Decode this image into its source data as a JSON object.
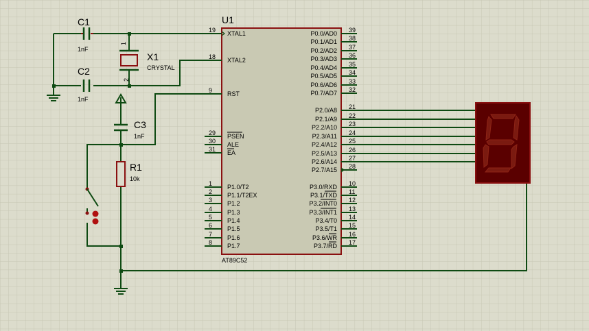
{
  "colors": {
    "background": "#dcdccc",
    "grid": "#c8c8b8",
    "wire": "#0e4a12",
    "component": "#8a1010",
    "chip_fill": "#c9c9b3",
    "display_fill": "#5a0000",
    "segment_off": "#7a1a10",
    "junction": "#0e4a12",
    "text": "#000000",
    "pin_number": "#000000"
  },
  "chip": {
    "ref": "U1",
    "part": "AT89C52",
    "left_pins": [
      {
        "num": "19",
        "name": "XTAL1"
      },
      {
        "num": "18",
        "name": "XTAL2"
      },
      {
        "num": "9",
        "name": "RST"
      },
      {
        "num": "29",
        "name": "PSEN"
      },
      {
        "num": "30",
        "name": "ALE"
      },
      {
        "num": "31",
        "name": "EA"
      },
      {
        "num": "1",
        "name": "P1.0/T2"
      },
      {
        "num": "2",
        "name": "P1.1/T2EX"
      },
      {
        "num": "3",
        "name": "P1.2"
      },
      {
        "num": "4",
        "name": "P1.3"
      },
      {
        "num": "5",
        "name": "P1.4"
      },
      {
        "num": "6",
        "name": "P1.5"
      },
      {
        "num": "7",
        "name": "P1.6"
      },
      {
        "num": "8",
        "name": "P1.7"
      }
    ],
    "right_pins": [
      {
        "num": "39",
        "name": "P0.0/AD0"
      },
      {
        "num": "38",
        "name": "P0.1/AD1"
      },
      {
        "num": "37",
        "name": "P0.2/AD2"
      },
      {
        "num": "36",
        "name": "P0.3/AD3"
      },
      {
        "num": "35",
        "name": "P0.4/AD4"
      },
      {
        "num": "34",
        "name": "P0.5/AD5"
      },
      {
        "num": "33",
        "name": "P0.6/AD6"
      },
      {
        "num": "32",
        "name": "P0.7/AD7"
      },
      {
        "num": "21",
        "name": "P2.0/A8"
      },
      {
        "num": "22",
        "name": "P2.1/A9"
      },
      {
        "num": "23",
        "name": "P2.2/A10"
      },
      {
        "num": "24",
        "name": "P2.3/A11"
      },
      {
        "num": "25",
        "name": "P2.4/A12"
      },
      {
        "num": "26",
        "name": "P2.5/A13"
      },
      {
        "num": "27",
        "name": "P2.6/A14"
      },
      {
        "num": "28",
        "name": "P2.7/A15"
      },
      {
        "num": "10",
        "name": "P3.0/RXD"
      },
      {
        "num": "11",
        "name": "P3.1/TXD"
      },
      {
        "num": "12",
        "name": "P3.2/INT0"
      },
      {
        "num": "13",
        "name": "P3.3/INT1"
      },
      {
        "num": "14",
        "name": "P3.4/T0"
      },
      {
        "num": "15",
        "name": "P3.5/T1"
      },
      {
        "num": "16",
        "name": "P3.6/WR"
      },
      {
        "num": "17",
        "name": "P3.7/RD"
      }
    ]
  },
  "components": {
    "c1": {
      "ref": "C1",
      "value": "1nF"
    },
    "c2": {
      "ref": "C2",
      "value": "1nF"
    },
    "c3": {
      "ref": "C3",
      "value": "1nF"
    },
    "x1": {
      "ref": "X1",
      "value": "CRYSTAL",
      "pin1": "1",
      "pin2": "2"
    },
    "r1": {
      "ref": "R1",
      "value": "10k"
    }
  }
}
